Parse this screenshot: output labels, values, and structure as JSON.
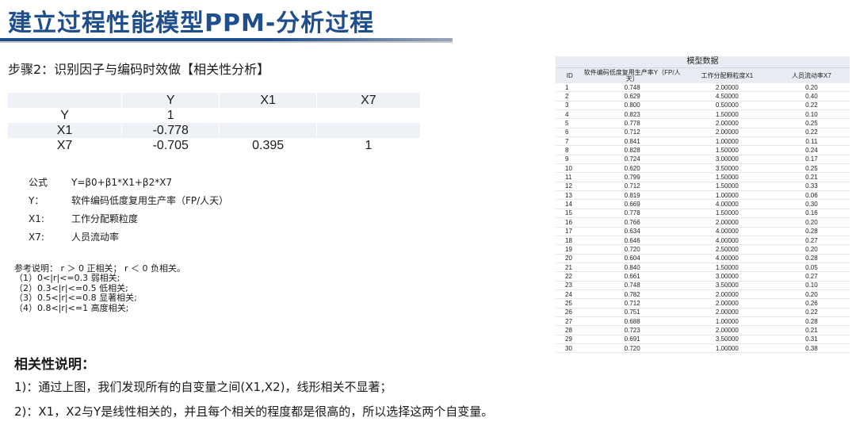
{
  "title": "建立过程性能模型PPM-分析过程",
  "step": "步骤2：识别因子与编码时效做【相关性分析】",
  "corr_table": {
    "header": [
      "",
      "Y",
      "X1",
      "X7"
    ],
    "rows": [
      [
        "Y",
        "1",
        "",
        ""
      ],
      [
        "X1",
        "-0.778",
        "",
        ""
      ],
      [
        "X7",
        "-0.705",
        "0.395",
        "1"
      ]
    ]
  },
  "formula": [
    {
      "k": "公式",
      "v": "Y=β0+β1*X1+β2*X7"
    },
    {
      "k": "Y：",
      "v": "软件编码低度复用生产率（FP/人天）"
    },
    {
      "k": "X1:",
      "v": "工作分配颗粒度"
    },
    {
      "k": "X7:",
      "v": "人员流动率"
    }
  ],
  "notes": [
    "参考说明： r ＞ 0 正相关； r ＜ 0 负相关。",
    "（1）0<|r|<=0.3 弱相关;",
    "（2）0.3<|r|<=0.5 低相关;",
    "（3）0.5<|r|<=0.8 显著相关;",
    "（4）0.8<|r|<=1 高度相关;"
  ],
  "heading": "相关性说明：",
  "paragraphs": [
    "1)：通过上图，我们发现所有的自变量之间(X1,X2)，线形相关不显著；",
    "2)：X1，X2与Y是线性相关的，并且每个相关的程度都是很高的，所以选择这两个自变量。"
  ],
  "data_table": {
    "caption": "模型数据",
    "headers": [
      "ID",
      "软件编码低度复用生产率Y（FP/人天）",
      "工作分配颗粒度X1",
      "人员流动率X7"
    ],
    "rows": [
      [
        "1",
        "0.748",
        "2.00000",
        "0.20"
      ],
      [
        "2",
        "0.629",
        "4.50000",
        "0.40"
      ],
      [
        "3",
        "0.800",
        "0.50000",
        "0.22"
      ],
      [
        "4",
        "0.823",
        "1.50000",
        "0.10"
      ],
      [
        "5",
        "0.778",
        "2.00000",
        "0.25"
      ],
      [
        "6",
        "0.712",
        "2.00000",
        "0.22"
      ],
      [
        "7",
        "0.841",
        "1.00000",
        "0.11"
      ],
      [
        "8",
        "0.828",
        "1.50000",
        "0.24"
      ],
      [
        "9",
        "0.724",
        "3.00000",
        "0.17"
      ],
      [
        "10",
        "0.620",
        "3.50000",
        "0.25"
      ],
      [
        "11",
        "0.799",
        "1.50000",
        "0.21"
      ],
      [
        "12",
        "0.712",
        "1.50000",
        "0.33"
      ],
      [
        "13",
        "0.819",
        "1.00000",
        "0.06"
      ],
      [
        "14",
        "0.669",
        "4.00000",
        "0.30"
      ],
      [
        "15",
        "0.778",
        "1.50000",
        "0.16"
      ],
      [
        "16",
        "0.766",
        "2.00000",
        "0.20"
      ],
      [
        "17",
        "0.634",
        "4.00000",
        "0.28"
      ],
      [
        "18",
        "0.646",
        "4.00000",
        "0.27"
      ],
      [
        "19",
        "0.720",
        "2.50000",
        "0.20"
      ],
      [
        "20",
        "0.604",
        "4.00000",
        "0.28"
      ],
      [
        "21",
        "0.840",
        "1.50000",
        "0.05"
      ],
      [
        "22",
        "0.661",
        "3.00000",
        "0.27"
      ],
      [
        "23",
        "0.748",
        "3.50000",
        "0.10"
      ],
      [
        "24",
        "0.782",
        "2.00000",
        "0.20"
      ],
      [
        "25",
        "0.712",
        "2.00000",
        "0.26"
      ],
      [
        "26",
        "0.751",
        "2.00000",
        "0.22"
      ],
      [
        "27",
        "0.688",
        "1.00000",
        "0.28"
      ],
      [
        "28",
        "0.723",
        "2.00000",
        "0.21"
      ],
      [
        "29",
        "0.691",
        "3.50000",
        "0.31"
      ],
      [
        "30",
        "0.720",
        "1.00000",
        "0.38"
      ]
    ]
  }
}
